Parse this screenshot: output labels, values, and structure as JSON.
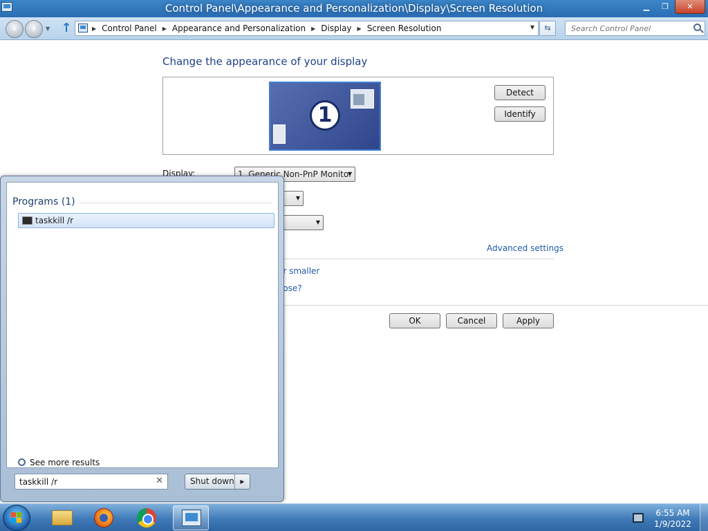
{
  "window": {
    "title": "Control Panel\\Appearance and Personalization\\Display\\Screen Resolution"
  },
  "address_bar": {
    "breadcrumbs": [
      "Control Panel",
      "Appearance and Personalization",
      "Display",
      "Screen Resolution"
    ],
    "search_placeholder": "Search Control Panel"
  },
  "main": {
    "heading": "Change the appearance of your display",
    "monitor_number": "1",
    "detect_label": "Detect",
    "identify_label": "Identify",
    "display_label": "Display:",
    "display_value": "1. Generic Non-PnP Monitor",
    "advanced_settings": "Advanced settings",
    "link_partial_1": "or smaller",
    "link_partial_2": "oose?",
    "ok_label": "OK",
    "cancel_label": "Cancel",
    "apply_label": "Apply"
  },
  "start_menu": {
    "section_title": "Programs (1)",
    "results": [
      "taskkill /r"
    ],
    "see_more": "See more results",
    "search_value": "taskkill /r",
    "shutdown_label": "Shut down"
  },
  "taskbar": {
    "time": "6:55 AM",
    "date": "1/9/2022",
    "pinned": [
      "windows-explorer",
      "firefox",
      "chrome",
      "control-panel"
    ]
  }
}
